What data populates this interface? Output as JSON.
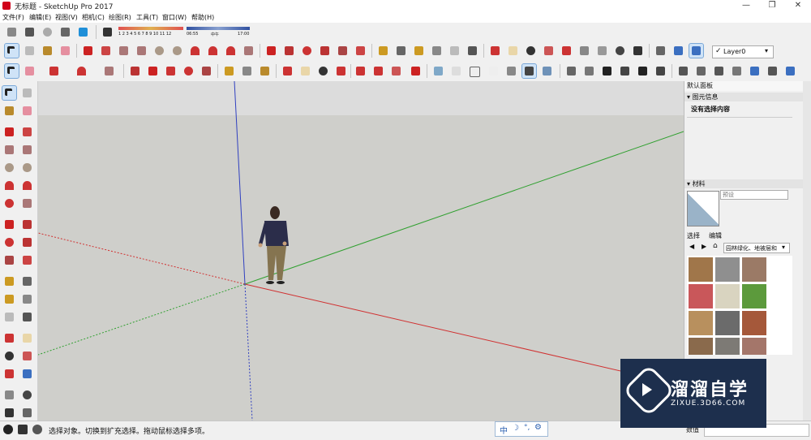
{
  "window": {
    "title": "无标题 - SketchUp Pro 2017",
    "minimize": "—",
    "restore": "❐",
    "close": "✕"
  },
  "menu": [
    "文件(F)",
    "编辑(E)",
    "视图(V)",
    "相机(C)",
    "绘图(R)",
    "工具(T)",
    "窗口(W)",
    "帮助(H)"
  ],
  "shadow_bar": {
    "months": "1 2 3 4 5 6 7 8 9 10 11 12",
    "time_start": "06:55",
    "time_mid": "中午",
    "time_end": "17:00"
  },
  "layer_select": {
    "value": "Layer0"
  },
  "right_panel": {
    "header": "默认面板",
    "entity_info": {
      "title": "图元信息",
      "content": "没有选择内容"
    },
    "materials": {
      "title": "材料",
      "name_placeholder": "预设",
      "tabs": [
        "选择",
        "编辑"
      ],
      "library": "园林绿化、地被层和",
      "swatches": [
        "#a0764a",
        "#8f8f8f",
        "#9b7a66",
        "#c9575a",
        "#d9d4c0",
        "#5c9a3c",
        "#b8905e",
        "#6b6b6b",
        "#a5583a",
        "#8a6a4c",
        "#7d7a75",
        "#a4766a"
      ]
    },
    "tray_label": "数值"
  },
  "statusbar": {
    "text": "选择对象。切换到扩充选择。拖动鼠标选择多项。",
    "ime": [
      "中",
      "☽",
      "°,",
      "⚙"
    ]
  },
  "watermark": {
    "title": "溜溜自学",
    "url": "ZIXUE.3D66.COM"
  },
  "colors": {
    "axis_red": "#d03030",
    "axis_green": "#30a030",
    "axis_blue": "#3040c0",
    "sky": "#dcdcdc",
    "ground": "#cfcfcb"
  }
}
